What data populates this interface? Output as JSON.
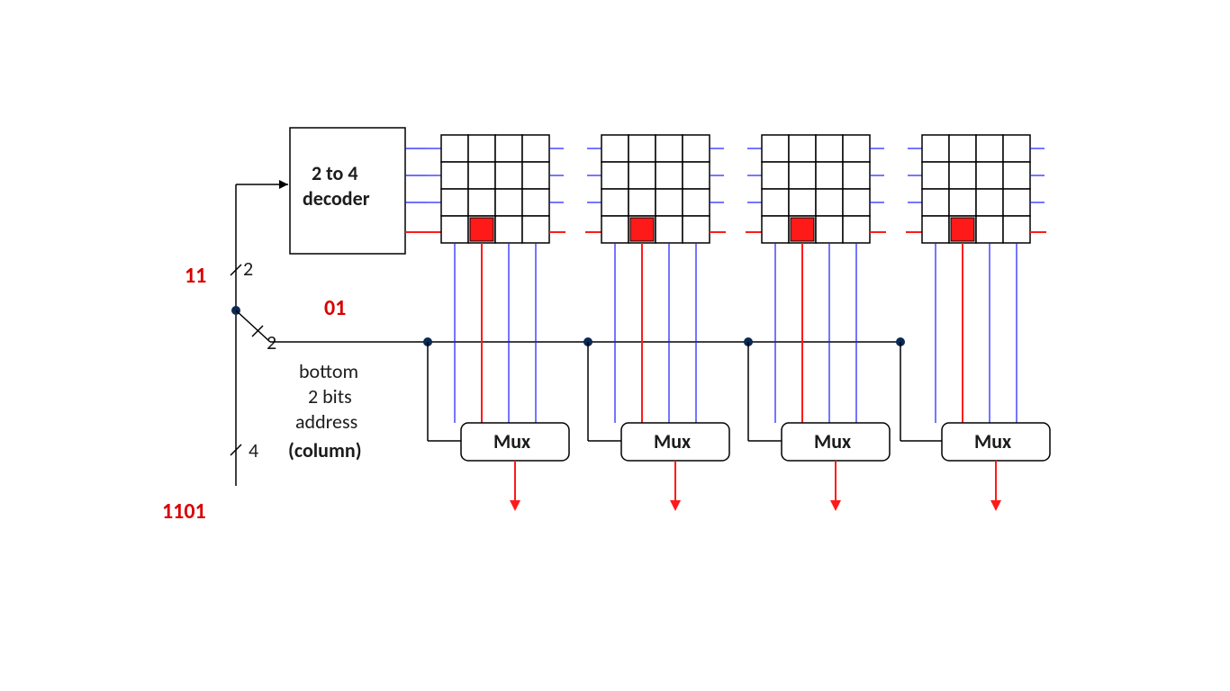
{
  "decoder": {
    "label_line1": "2 to 4",
    "label_line2": "decoder"
  },
  "mux": {
    "label": "Mux"
  },
  "address": {
    "full": "1101",
    "row_bits": "11",
    "col_bits": "01",
    "row_width": "2",
    "col_width": "2",
    "full_width": "4"
  },
  "note": {
    "line1": "bottom",
    "line2": "2 bits",
    "line3": "address",
    "line4": "(column)"
  },
  "banks": {
    "count": 4,
    "grid_cols": 4,
    "grid_rows": 4,
    "selected_row": 3,
    "selected_col": 1
  }
}
